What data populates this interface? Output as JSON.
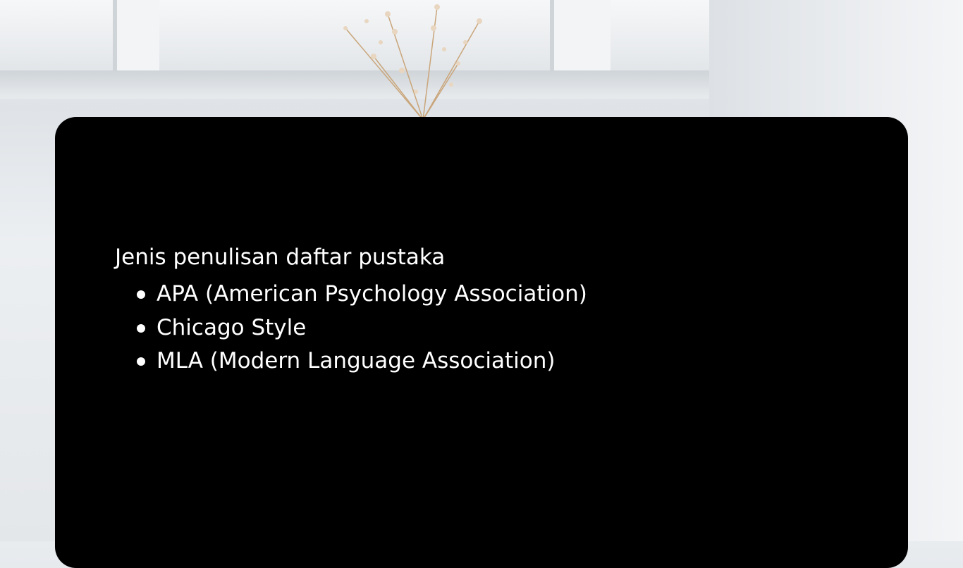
{
  "slide": {
    "heading": "Jenis penulisan daftar pustaka",
    "bullets": [
      "APA (American Psychology Association)",
      "Chicago Style",
      "MLA (Modern Language Association)"
    ]
  },
  "colors": {
    "panel": "#000000",
    "text": "#ffffff"
  }
}
